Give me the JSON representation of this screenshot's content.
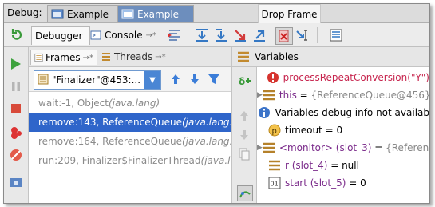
{
  "debug_bar": {
    "label": "Debug:",
    "tabs": [
      {
        "label": "Example"
      },
      {
        "label": "Example"
      }
    ]
  },
  "tooltip": "Drop Frame",
  "toolbar": {
    "debugger_tab": "Debugger",
    "console_tab": "Console",
    "console_pin": "→*"
  },
  "frames_panel": {
    "tab_frames": "Frames",
    "tab_frames_pin": "→*",
    "tab_threads": "Threads",
    "tab_threads_pin": "→*",
    "thread_selected": "\"Finalizer\"@453:...",
    "frames": [
      {
        "method": "wait:-1, Object ",
        "cls": "(java.lang)",
        "selected": false
      },
      {
        "method": "remove:143, ReferenceQueue ",
        "cls": "(java.lang.r",
        "selected": true
      },
      {
        "method": "remove:164, ReferenceQueue ",
        "cls": "(java.lang.r",
        "selected": false
      },
      {
        "method": "run:209, Finalizer$FinalizerThread ",
        "cls": "(java.la",
        "selected": false
      }
    ]
  },
  "variables_panel": {
    "title": "Variables",
    "rows": [
      {
        "expandable": false,
        "icon": "error-icon",
        "name": "processRepeatConversion(\"Y\")",
        "eq": "",
        "value": "",
        "kind": "error"
      },
      {
        "expandable": true,
        "icon": "field-icon",
        "name": "this",
        "eq": " = ",
        "value": "{ReferenceQueue@456}",
        "kind": "gray"
      },
      {
        "expandable": false,
        "icon": "info-icon",
        "name": "Variables debug info not availab",
        "eq": "",
        "value": "",
        "kind": "plain"
      },
      {
        "expandable": false,
        "icon": "param-icon",
        "name": "timeout",
        "eq": " = ",
        "value": "0",
        "kind": "plain"
      },
      {
        "expandable": true,
        "icon": "field-icon",
        "name": "<monitor> (slot_3)",
        "eq": " = ",
        "value": "{Referenc",
        "kind": "purple"
      },
      {
        "expandable": false,
        "icon": "field-icon",
        "name": "r (slot_4)",
        "eq": " = ",
        "value": "null",
        "kind": "purple"
      },
      {
        "expandable": false,
        "icon": "number-icon",
        "name": "start (slot_5)",
        "eq": " = ",
        "value": "0",
        "kind": "purple"
      }
    ]
  },
  "colors": {
    "selection": "#2f65ca",
    "active_tab": "#6d8ebd",
    "error_red": "#c7254e"
  }
}
